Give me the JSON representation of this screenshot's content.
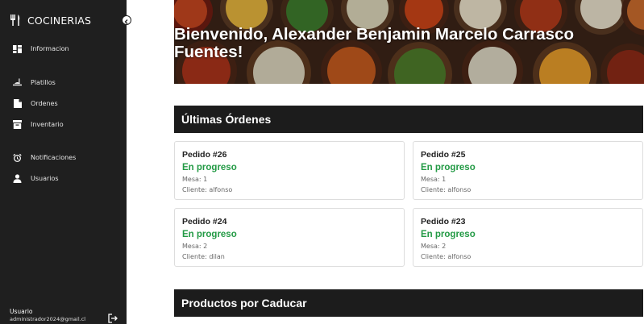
{
  "sidebar": {
    "brand": "COCINERIAS",
    "items": [
      {
        "label": "Informacion",
        "icon": "dashboard-icon"
      },
      {
        "label": "Platillos",
        "icon": "dish-icon"
      },
      {
        "label": "Ordenes",
        "icon": "orders-icon"
      },
      {
        "label": "Inventario",
        "icon": "inventory-icon"
      },
      {
        "label": "Notificaciones",
        "icon": "alarm-icon"
      },
      {
        "label": "Usuarios",
        "icon": "user-icon"
      }
    ],
    "user_label": "Usuario",
    "user_email": "administrador2024@gmail.cl"
  },
  "hero": {
    "title": "Bienvenido, Alexander Benjamin Marcelo Carrasco Fuentes!"
  },
  "orders": {
    "header": "Últimas Órdenes",
    "mesa_prefix": "Mesa: ",
    "cliente_prefix": "Cliente: ",
    "items": [
      {
        "title": "Pedido #26",
        "status": "En progreso",
        "mesa": "1",
        "cliente": "alfonso"
      },
      {
        "title": "Pedido #25",
        "status": "En progreso",
        "mesa": "1",
        "cliente": "alfonso"
      },
      {
        "title": "Pedido #24",
        "status": "En progreso",
        "mesa": "2",
        "cliente": "dilan"
      },
      {
        "title": "Pedido #23",
        "status": "En progreso",
        "mesa": "2",
        "cliente": "alfonso"
      }
    ]
  },
  "expiring": {
    "header": "Productos por Caducar"
  },
  "colors": {
    "sidebar_bg": "#1f1f1f",
    "header_bg": "#1c1c1c",
    "status_green": "#239a45"
  }
}
